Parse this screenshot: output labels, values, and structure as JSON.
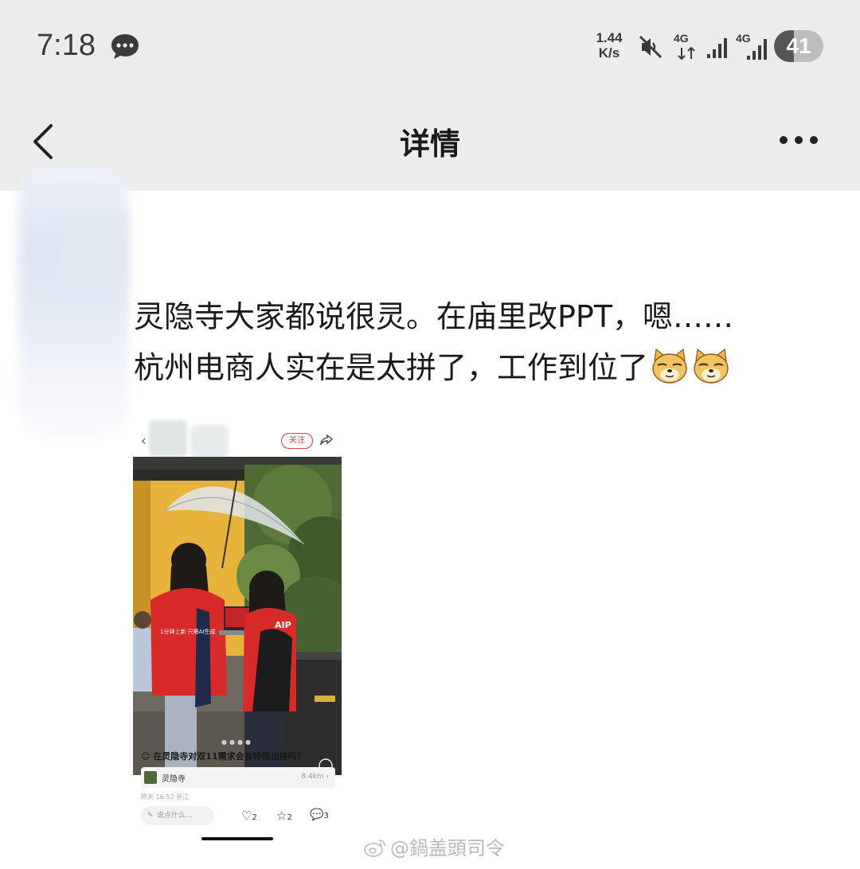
{
  "status_bar": {
    "time": "7:18",
    "net_speed_value": "1.44",
    "net_speed_unit": "K/s",
    "signal1_label": "4G",
    "signal2_label": "4G",
    "battery": "41",
    "battery_level": 0.41,
    "icons": [
      "message-bubble-icon",
      "mute-icon",
      "data-arrows-icon",
      "signal-bars-icon",
      "signal-bars-icon",
      "battery-icon"
    ]
  },
  "nav": {
    "title": "详情",
    "back_icon": "chevron-left-icon",
    "more_icon": "more-dots-icon"
  },
  "post": {
    "line1": "灵隐寺大家都说很灵。在庙里改PPT，嗯……",
    "line2": "杭州电商人实在是太拼了，工作到位了",
    "emojis": [
      "doge-emoji",
      "doge-emoji"
    ]
  },
  "embedded_post": {
    "follow_label": "关注",
    "title": "在灵隐寺对双11需求会有特殊加持吗?",
    "location": "灵隐寺",
    "distance": "8.4km ›",
    "time": "昨天 16:52 浙江",
    "comment_placeholder": "说点什么...",
    "likes": "2",
    "favorites": "2",
    "comments": "3",
    "shirt_text_left": "1分钟上新 只需AI生成",
    "shirt_text_right": "AIP"
  },
  "watermark": "@鍋盖頭司令",
  "colors": {
    "bar_bg": "#ececec",
    "accent_red": "#e23b4a"
  }
}
